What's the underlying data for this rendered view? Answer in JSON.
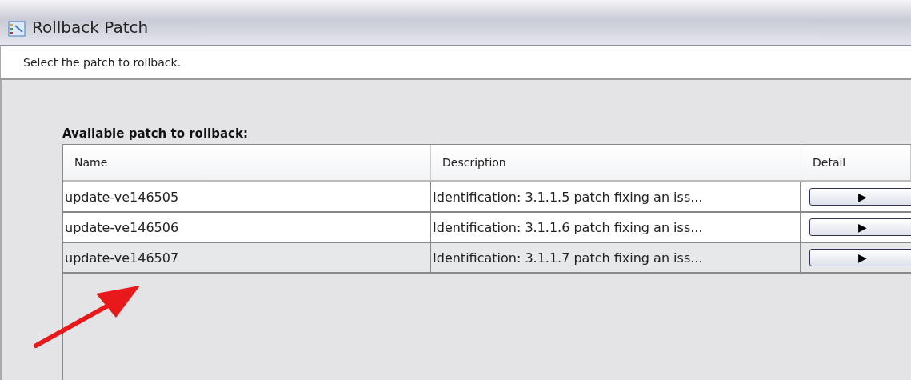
{
  "window": {
    "title": "Rollback Patch"
  },
  "instruction": "Select the patch to rollback.",
  "table": {
    "label": "Available patch to rollback:",
    "columns": [
      "Name",
      "Description",
      "Detail"
    ],
    "rows": [
      {
        "name": "update-ve146505",
        "description": "Identification: 3.1.1.5 patch fixing an iss...",
        "detail": "▶",
        "selected": false
      },
      {
        "name": "update-ve146506",
        "description": "Identification: 3.1.1.6 patch fixing an iss...",
        "detail": "▶",
        "selected": false
      },
      {
        "name": "update-ve146507",
        "description": "Identification: 3.1.1.7 patch fixing an iss...",
        "detail": "▶",
        "selected": true
      }
    ]
  }
}
